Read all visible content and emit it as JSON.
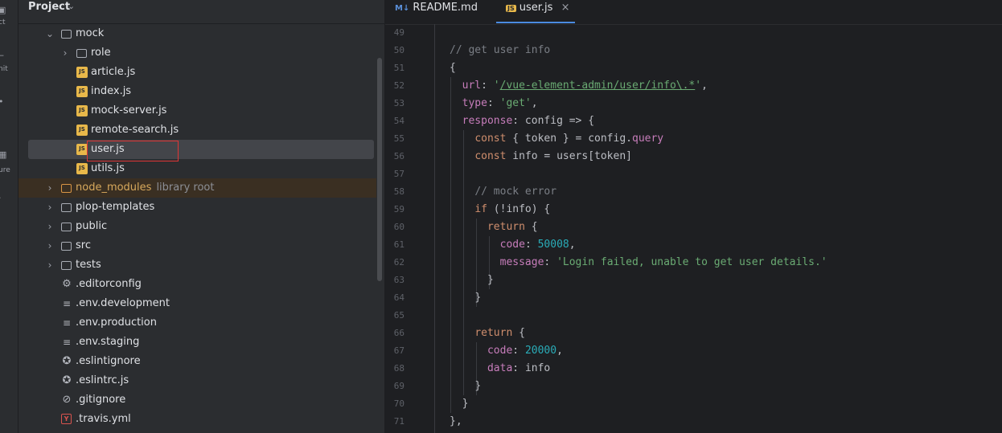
{
  "strip": {
    "labels": [
      "ct",
      "nit",
      "ure"
    ]
  },
  "project": {
    "title": "Project",
    "items": [
      {
        "name": "mock",
        "type": "folder",
        "expanded": true
      },
      {
        "name": "role",
        "type": "folder",
        "expanded": false
      },
      {
        "name": "article.js",
        "type": "js"
      },
      {
        "name": "index.js",
        "type": "js"
      },
      {
        "name": "mock-server.js",
        "type": "js"
      },
      {
        "name": "remote-search.js",
        "type": "js"
      },
      {
        "name": "user.js",
        "type": "js",
        "selected": true
      },
      {
        "name": "utils.js",
        "type": "js"
      },
      {
        "name": "node_modules",
        "type": "folder",
        "hint": "library root",
        "expanded": false
      },
      {
        "name": "plop-templates",
        "type": "folder",
        "expanded": false
      },
      {
        "name": "public",
        "type": "folder",
        "expanded": false
      },
      {
        "name": "src",
        "type": "folder",
        "expanded": false
      },
      {
        "name": "tests",
        "type": "folder",
        "expanded": false
      },
      {
        "name": ".editorconfig",
        "type": "config"
      },
      {
        "name": ".env.development",
        "type": "text"
      },
      {
        "name": ".env.production",
        "type": "text"
      },
      {
        "name": ".env.staging",
        "type": "text"
      },
      {
        "name": ".eslintignore",
        "type": "eslint"
      },
      {
        "name": ".eslintrc.js",
        "type": "eslint"
      },
      {
        "name": ".gitignore",
        "type": "ignore"
      },
      {
        "name": ".travis.yml",
        "type": "yaml"
      }
    ]
  },
  "editor": {
    "tabs": [
      {
        "icon": "M↓",
        "label": "README.md",
        "active": false
      },
      {
        "icon": "JS",
        "label": "user.js",
        "active": true,
        "close": "×"
      }
    ],
    "line_numbers": [
      "49",
      "50",
      "51",
      "52",
      "53",
      "54",
      "55",
      "56",
      "57",
      "58",
      "59",
      "60",
      "61",
      "62",
      "63",
      "64",
      "65",
      "66",
      "67",
      "68",
      "69",
      "70",
      "71"
    ],
    "code": {
      "l50": "// get user info",
      "l51": "{",
      "l52_key": "url",
      "l52_url": "/vue-element-admin/user/info\\.*",
      "l53_key": "type",
      "l53_val": "'get'",
      "l54_key": "response",
      "l54_rest": ": config => {",
      "l55_kw": "const",
      "l55_mid": " { token } = config.",
      "l55_prop": "query",
      "l56_kw": "const",
      "l56_rest": " info = users[token]",
      "l58": "// mock error",
      "l59_kw": "if",
      "l59_rest": " (!info) {",
      "l60_kw": "return",
      "l60_rest": " {",
      "l61_key": "code",
      "l61_val": "50008",
      "l62_key": "message",
      "l62_val": "'Login failed, unable to get user details.'",
      "l63": "}",
      "l64": "}",
      "l66_kw": "return",
      "l66_rest": " {",
      "l67_key": "code",
      "l67_val": "20000",
      "l68_key": "data",
      "l68_val": "info",
      "l69": "}",
      "l70": "}",
      "l71": "},"
    }
  }
}
